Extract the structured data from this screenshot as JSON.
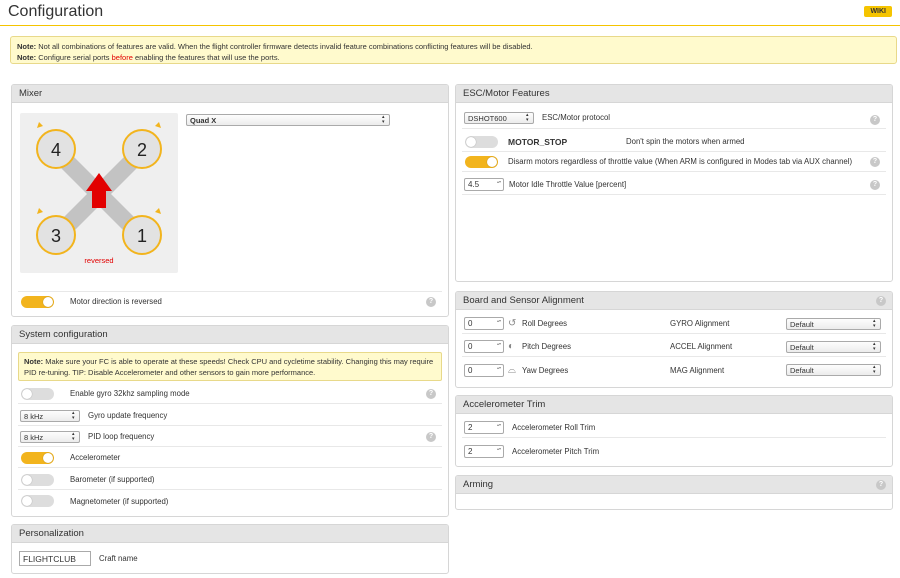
{
  "header": {
    "title": "Configuration",
    "wiki_label": "WIKI"
  },
  "note": {
    "line1_bold": "Note:",
    "line1_text": " Not all combinations of features are valid. When the flight controller firmware detects invalid feature combinations conflicting features will be disabled.",
    "line2_bold": "Note:",
    "line2_pre": " Configure serial ports ",
    "line2_red": "before",
    "line2_post": " enabling the features that will use the ports."
  },
  "mixer": {
    "title": "Mixer",
    "selected": "Quad X",
    "motors": [
      "1",
      "2",
      "3",
      "4"
    ],
    "reversed_label": "reversed",
    "motor_direction_label": "Motor direction is reversed",
    "motor_direction_on": true
  },
  "system": {
    "title": "System configuration",
    "note_bold": "Note:",
    "note_text": " Make sure your FC is able to operate at these speeds! Check CPU and cycletime stability. Changing this may require PID re-tuning. TIP: Disable Accelerometer and other sensors to gain more performance.",
    "gyro32_label": "Enable gyro 32khz sampling mode",
    "gyro_freq_value": "8 kHz",
    "gyro_freq_label": "Gyro update frequency",
    "pid_freq_value": "8 kHz",
    "pid_freq_label": "PID loop frequency",
    "accel_label": "Accelerometer",
    "baro_label": "Barometer (if supported)",
    "mag_label": "Magnetometer (if supported)"
  },
  "personalization": {
    "title": "Personalization",
    "craft_name_value": "FLIGHTCLUB",
    "craft_name_label": "Craft name"
  },
  "esc": {
    "title": "ESC/Motor Features",
    "protocol_value": "DSHOT600",
    "protocol_label": "ESC/Motor protocol",
    "motor_stop_label": "MOTOR_STOP",
    "motor_stop_desc": "Don't spin the motors when armed",
    "disarm_label": "Disarm motors regardless of throttle value (When ARM is configured in Modes tab via AUX channel)",
    "idle_value": "4.5",
    "idle_label": "Motor Idle Throttle Value [percent]"
  },
  "alignment": {
    "title": "Board and Sensor Alignment",
    "roll_value": "0",
    "roll_label": "Roll Degrees",
    "pitch_value": "0",
    "pitch_label": "Pitch Degrees",
    "yaw_value": "0",
    "yaw_label": "Yaw Degrees",
    "gyro_label": "GYRO Alignment",
    "gyro_value": "Default",
    "accel_label": "ACCEL Alignment",
    "accel_value": "Default",
    "mag_label": "MAG Alignment",
    "mag_value": "Default"
  },
  "acc_trim": {
    "title": "Accelerometer Trim",
    "roll_value": "2",
    "roll_label": "Accelerometer Roll Trim",
    "pitch_value": "2",
    "pitch_label": "Accelerometer Pitch Trim"
  },
  "arming": {
    "title": "Arming"
  },
  "help_glyph": "?",
  "colors": {
    "accent": "#f2b41d",
    "note_bg": "#fffacd",
    "arrow": "#e20000"
  }
}
